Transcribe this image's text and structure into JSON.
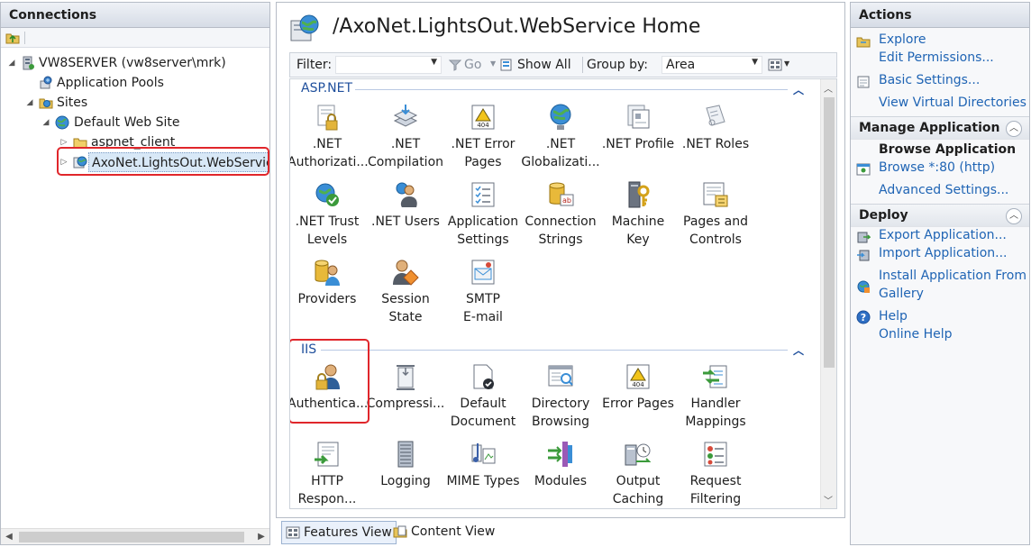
{
  "connections": {
    "title": "Connections",
    "tree": [
      {
        "label": "VW8SERVER (vw8server\\mrk)",
        "icon": "server-icon"
      },
      {
        "label": "Application Pools",
        "icon": "app-pools-icon"
      },
      {
        "label": "Sites",
        "icon": "sites-folder-icon"
      },
      {
        "label": "Default Web Site",
        "icon": "globe-icon"
      },
      {
        "label": "aspnet_client",
        "icon": "folder-icon"
      },
      {
        "label": "AxoNet.LightsOut.WebService",
        "icon": "web-app-icon"
      }
    ]
  },
  "main": {
    "title": "/AxoNet.LightsOut.WebService Home",
    "filter": {
      "label": "Filter:",
      "go": "Go",
      "show_all": "Show All",
      "group_by_label": "Group by:",
      "group_by_value": "Area"
    },
    "groups": [
      {
        "name": "ASP.NET",
        "features": [
          {
            "l1": ".NET",
            "l2": "Authorizati..."
          },
          {
            "l1": ".NET",
            "l2": "Compilation"
          },
          {
            "l1": ".NET Error",
            "l2": "Pages"
          },
          {
            "l1": ".NET",
            "l2": "Globalizati..."
          },
          {
            "l1": ".NET Profile",
            "l2": ""
          },
          {
            "l1": ".NET Roles",
            "l2": ""
          },
          {
            "l1": ".NET Trust",
            "l2": "Levels"
          },
          {
            "l1": ".NET Users",
            "l2": ""
          },
          {
            "l1": "Application",
            "l2": "Settings"
          },
          {
            "l1": "Connection",
            "l2": "Strings"
          },
          {
            "l1": "Machine",
            "l2": "Key"
          },
          {
            "l1": "Pages and",
            "l2": "Controls"
          },
          {
            "l1": "Providers",
            "l2": ""
          },
          {
            "l1": "Session",
            "l2": "State"
          },
          {
            "l1": "SMTP",
            "l2": "E-mail"
          }
        ]
      },
      {
        "name": "IIS",
        "features": [
          {
            "l1": "Authentica...",
            "l2": ""
          },
          {
            "l1": "Compressi...",
            "l2": ""
          },
          {
            "l1": "Default",
            "l2": "Document"
          },
          {
            "l1": "Directory",
            "l2": "Browsing"
          },
          {
            "l1": "Error Pages",
            "l2": ""
          },
          {
            "l1": "Handler",
            "l2": "Mappings"
          },
          {
            "l1": "HTTP",
            "l2": "Respon..."
          },
          {
            "l1": "Logging",
            "l2": ""
          },
          {
            "l1": "MIME Types",
            "l2": ""
          },
          {
            "l1": "Modules",
            "l2": ""
          },
          {
            "l1": "Output",
            "l2": "Caching"
          },
          {
            "l1": "Request",
            "l2": "Filtering"
          }
        ]
      }
    ],
    "tabs": {
      "features_view": "Features View",
      "content_view": "Content View"
    }
  },
  "actions": {
    "title": "Actions",
    "explore": "Explore",
    "edit_permissions": "Edit Permissions...",
    "basic_settings": "Basic Settings...",
    "view_virtual_directories": "View Virtual Directories",
    "manage_application": {
      "title": "Manage Application",
      "browse_title": "Browse Application",
      "browse": "Browse *:80 (http)",
      "advanced": "Advanced Settings..."
    },
    "deploy": {
      "title": "Deploy",
      "export": "Export Application...",
      "import": "Import Application...",
      "install_1": "Install Application From",
      "install_2": "Gallery"
    },
    "help": "Help",
    "online_help": "Online Help"
  },
  "colors": {
    "link": "#1f64b4",
    "highlight": "#e0262b",
    "group_header": "#1f4f9c"
  }
}
